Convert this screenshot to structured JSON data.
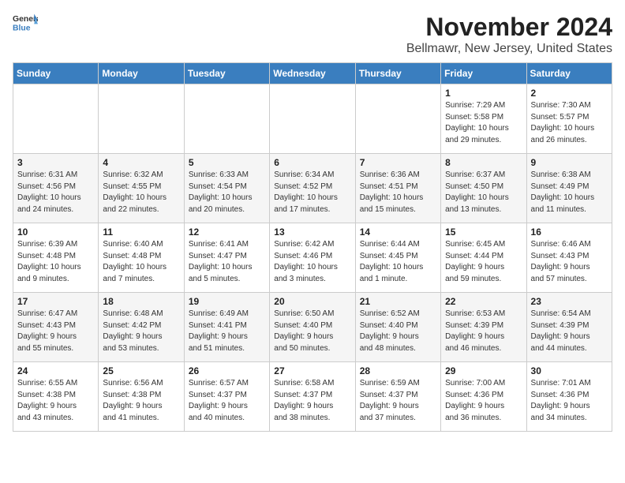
{
  "logo": {
    "line1": "General",
    "line2": "Blue"
  },
  "title": "November 2024",
  "location": "Bellmawr, New Jersey, United States",
  "weekdays": [
    "Sunday",
    "Monday",
    "Tuesday",
    "Wednesday",
    "Thursday",
    "Friday",
    "Saturday"
  ],
  "weeks": [
    [
      {
        "day": "",
        "info": ""
      },
      {
        "day": "",
        "info": ""
      },
      {
        "day": "",
        "info": ""
      },
      {
        "day": "",
        "info": ""
      },
      {
        "day": "",
        "info": ""
      },
      {
        "day": "1",
        "info": "Sunrise: 7:29 AM\nSunset: 5:58 PM\nDaylight: 10 hours\nand 29 minutes."
      },
      {
        "day": "2",
        "info": "Sunrise: 7:30 AM\nSunset: 5:57 PM\nDaylight: 10 hours\nand 26 minutes."
      }
    ],
    [
      {
        "day": "3",
        "info": "Sunrise: 6:31 AM\nSunset: 4:56 PM\nDaylight: 10 hours\nand 24 minutes."
      },
      {
        "day": "4",
        "info": "Sunrise: 6:32 AM\nSunset: 4:55 PM\nDaylight: 10 hours\nand 22 minutes."
      },
      {
        "day": "5",
        "info": "Sunrise: 6:33 AM\nSunset: 4:54 PM\nDaylight: 10 hours\nand 20 minutes."
      },
      {
        "day": "6",
        "info": "Sunrise: 6:34 AM\nSunset: 4:52 PM\nDaylight: 10 hours\nand 17 minutes."
      },
      {
        "day": "7",
        "info": "Sunrise: 6:36 AM\nSunset: 4:51 PM\nDaylight: 10 hours\nand 15 minutes."
      },
      {
        "day": "8",
        "info": "Sunrise: 6:37 AM\nSunset: 4:50 PM\nDaylight: 10 hours\nand 13 minutes."
      },
      {
        "day": "9",
        "info": "Sunrise: 6:38 AM\nSunset: 4:49 PM\nDaylight: 10 hours\nand 11 minutes."
      }
    ],
    [
      {
        "day": "10",
        "info": "Sunrise: 6:39 AM\nSunset: 4:48 PM\nDaylight: 10 hours\nand 9 minutes."
      },
      {
        "day": "11",
        "info": "Sunrise: 6:40 AM\nSunset: 4:48 PM\nDaylight: 10 hours\nand 7 minutes."
      },
      {
        "day": "12",
        "info": "Sunrise: 6:41 AM\nSunset: 4:47 PM\nDaylight: 10 hours\nand 5 minutes."
      },
      {
        "day": "13",
        "info": "Sunrise: 6:42 AM\nSunset: 4:46 PM\nDaylight: 10 hours\nand 3 minutes."
      },
      {
        "day": "14",
        "info": "Sunrise: 6:44 AM\nSunset: 4:45 PM\nDaylight: 10 hours\nand 1 minute."
      },
      {
        "day": "15",
        "info": "Sunrise: 6:45 AM\nSunset: 4:44 PM\nDaylight: 9 hours\nand 59 minutes."
      },
      {
        "day": "16",
        "info": "Sunrise: 6:46 AM\nSunset: 4:43 PM\nDaylight: 9 hours\nand 57 minutes."
      }
    ],
    [
      {
        "day": "17",
        "info": "Sunrise: 6:47 AM\nSunset: 4:43 PM\nDaylight: 9 hours\nand 55 minutes."
      },
      {
        "day": "18",
        "info": "Sunrise: 6:48 AM\nSunset: 4:42 PM\nDaylight: 9 hours\nand 53 minutes."
      },
      {
        "day": "19",
        "info": "Sunrise: 6:49 AM\nSunset: 4:41 PM\nDaylight: 9 hours\nand 51 minutes."
      },
      {
        "day": "20",
        "info": "Sunrise: 6:50 AM\nSunset: 4:40 PM\nDaylight: 9 hours\nand 50 minutes."
      },
      {
        "day": "21",
        "info": "Sunrise: 6:52 AM\nSunset: 4:40 PM\nDaylight: 9 hours\nand 48 minutes."
      },
      {
        "day": "22",
        "info": "Sunrise: 6:53 AM\nSunset: 4:39 PM\nDaylight: 9 hours\nand 46 minutes."
      },
      {
        "day": "23",
        "info": "Sunrise: 6:54 AM\nSunset: 4:39 PM\nDaylight: 9 hours\nand 44 minutes."
      }
    ],
    [
      {
        "day": "24",
        "info": "Sunrise: 6:55 AM\nSunset: 4:38 PM\nDaylight: 9 hours\nand 43 minutes."
      },
      {
        "day": "25",
        "info": "Sunrise: 6:56 AM\nSunset: 4:38 PM\nDaylight: 9 hours\nand 41 minutes."
      },
      {
        "day": "26",
        "info": "Sunrise: 6:57 AM\nSunset: 4:37 PM\nDaylight: 9 hours\nand 40 minutes."
      },
      {
        "day": "27",
        "info": "Sunrise: 6:58 AM\nSunset: 4:37 PM\nDaylight: 9 hours\nand 38 minutes."
      },
      {
        "day": "28",
        "info": "Sunrise: 6:59 AM\nSunset: 4:37 PM\nDaylight: 9 hours\nand 37 minutes."
      },
      {
        "day": "29",
        "info": "Sunrise: 7:00 AM\nSunset: 4:36 PM\nDaylight: 9 hours\nand 36 minutes."
      },
      {
        "day": "30",
        "info": "Sunrise: 7:01 AM\nSunset: 4:36 PM\nDaylight: 9 hours\nand 34 minutes."
      }
    ]
  ]
}
